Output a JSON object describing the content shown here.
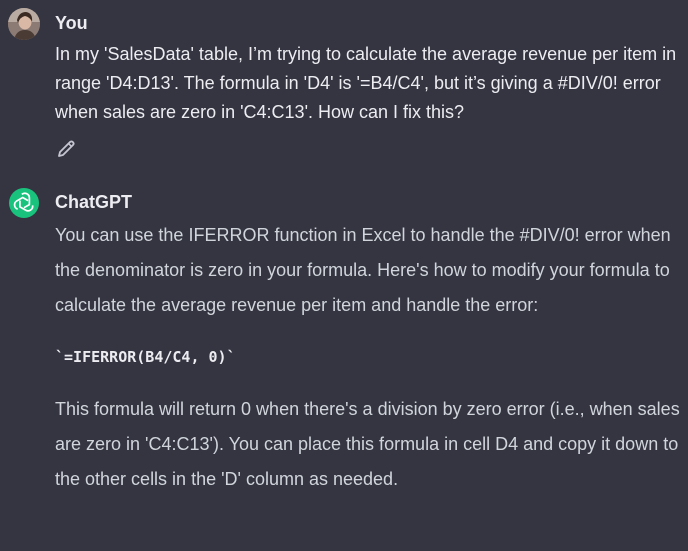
{
  "user": {
    "name": "You",
    "message": "In my 'SalesData' table, I’m trying to calculate the average revenue per item in range 'D4:D13'. The formula in 'D4' is '=B4/C4', but it’s giving a #DIV/0! error when sales are zero in 'C4:C13'. How can I fix this?",
    "edit_icon": "pencil-icon"
  },
  "assistant": {
    "name": "ChatGPT",
    "paragraph1": "You can use the IFERROR function in Excel to handle the #DIV/0! error when the denominator is zero in your formula. Here's how to modify your formula to calculate the average revenue per item and handle the error:",
    "code": "`=IFERROR(B4/C4, 0)`",
    "paragraph2": "This formula will return 0 when there's a division by zero error (i.e., when sales are zero in 'C4:C13'). You can place this formula in cell D4 and copy it down to the other cells in the 'D' column as needed.",
    "avatar_icon": "openai-logo-icon"
  },
  "colors": {
    "background": "#343541",
    "text_primary": "#ececf1",
    "text_secondary": "#d1d5db",
    "gpt_avatar": "#19c37d"
  }
}
